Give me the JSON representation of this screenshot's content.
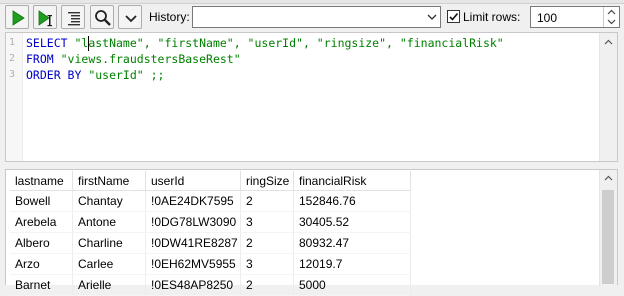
{
  "toolbar": {
    "buttons": [
      {
        "name": "run-button",
        "icon": "play-icon"
      },
      {
        "name": "run-single-button",
        "icon": "play-step-icon"
      },
      {
        "name": "format-button",
        "icon": "format-text-icon"
      },
      {
        "name": "search-button",
        "icon": "magnifier-icon"
      },
      {
        "name": "more-button",
        "icon": "chevron-down-icon"
      }
    ],
    "history_label": "History:",
    "history_value": "",
    "limit_rows_label": "Limit rows:",
    "limit_rows_checked": true,
    "limit_rows_value": "100"
  },
  "editor": {
    "line_numbers": [
      "1",
      "2",
      "3"
    ],
    "lines": [
      {
        "kw": "SELECT ",
        "str": "\"lastName\", \"firstName\", \"userId\", \"ringsize\", \"financialRisk\""
      },
      {
        "kw": "FROM ",
        "str": "\"views.fraudstersBaseRest\""
      },
      {
        "kw": "ORDER BY ",
        "str": "\"userId\" ;;"
      }
    ]
  },
  "results": {
    "columns": [
      "lastname",
      "firstName",
      "userId",
      "ringSize",
      "financialRisk"
    ],
    "rows": [
      [
        "Bowell",
        "Chantay",
        "!0AE24DK7595",
        "2",
        "152846.76"
      ],
      [
        "Arebela",
        "Antone",
        "!0DG78LW3090",
        "3",
        "30405.52"
      ],
      [
        "Albero",
        "Charline",
        "!0DW41RE8287",
        "2",
        "80932.47"
      ],
      [
        "Arzo",
        "Carlee",
        "!0EH62MV5955",
        "3",
        "12019.7"
      ],
      [
        "Barnet",
        "Arielle",
        "!0ES48AP8250",
        "2",
        "5000"
      ]
    ]
  },
  "colors": {
    "keyword": "#0000c8",
    "string": "#008000",
    "run_green": "#1ea01e"
  }
}
